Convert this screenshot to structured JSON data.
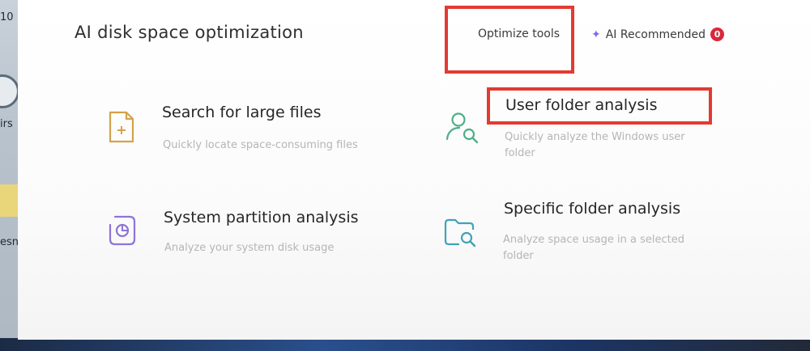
{
  "app": {
    "title": "AI disk space optimization"
  },
  "tabs": {
    "optimize_label": "Optimize tools",
    "ai_label": "AI Recommended",
    "ai_badge": "0"
  },
  "tools": [
    {
      "name": "Search for large files",
      "description": "Quickly locate space-consuming files",
      "icon": "add-file-icon",
      "color": "#d4a24a"
    },
    {
      "name": "User folder analysis",
      "description": "Quickly analyze the Windows user folder",
      "icon": "user-search-icon",
      "color": "#4fae8a"
    },
    {
      "name": "System partition analysis",
      "description": "Analyze your system disk usage",
      "icon": "disk-chart-icon",
      "color": "#8e74d8"
    },
    {
      "name": "Specific folder analysis",
      "description": "Analyze space usage in a selected folder",
      "icon": "folder-search-icon",
      "color": "#3fa3b8"
    }
  ],
  "desktop": {
    "fragments": [
      "10",
      "irs",
      "esn"
    ]
  }
}
